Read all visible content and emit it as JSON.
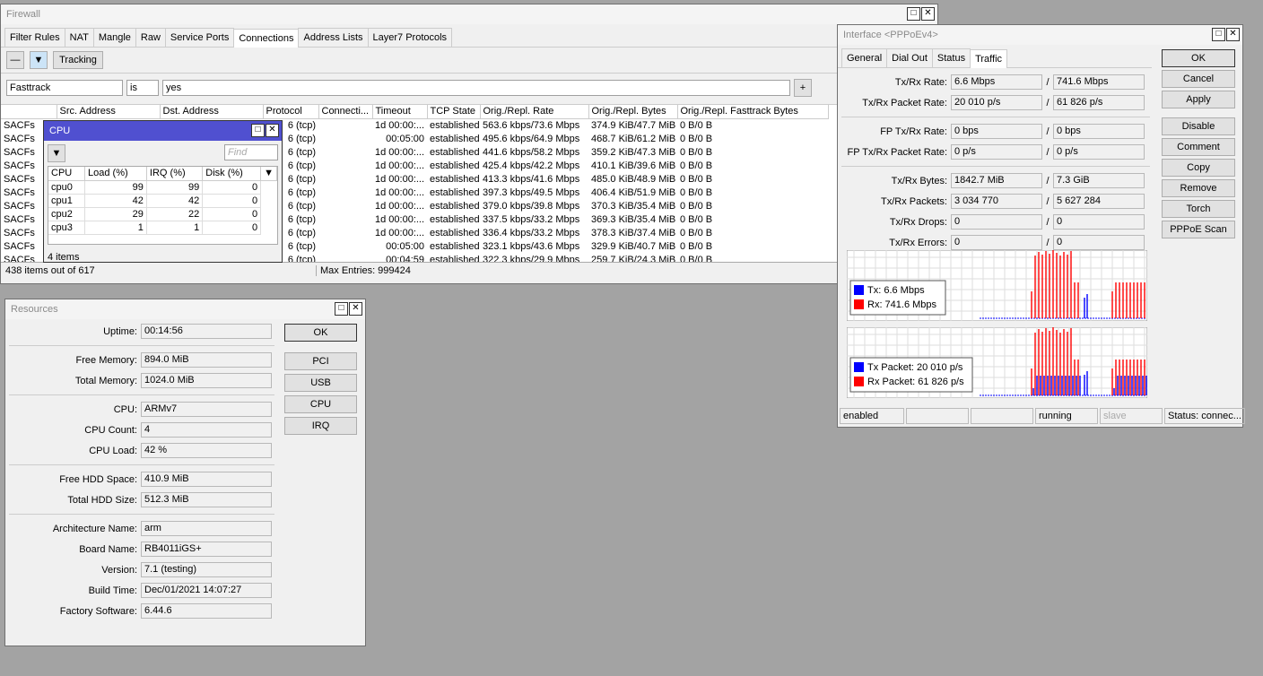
{
  "firewall": {
    "title": "Firewall",
    "tabs": [
      "Filter Rules",
      "NAT",
      "Mangle",
      "Raw",
      "Service Ports",
      "Connections",
      "Address Lists",
      "Layer7 Protocols"
    ],
    "active_tab": "Connections",
    "tracking_label": "Tracking",
    "filter": {
      "field": "Fasttrack",
      "op": "is",
      "value": "yes"
    },
    "columns": [
      "",
      "Src. Address",
      "Dst. Address",
      "Protocol",
      "Connecti...",
      "Timeout",
      "TCP State",
      "Orig./Repl. Rate",
      "Orig./Repl. Bytes",
      "Orig./Repl. Fasttrack Bytes"
    ],
    "rows": [
      [
        "SACFs",
        "6 (tcp)",
        "1d 00:00:...",
        "established",
        "563.6 kbps/73.6 Mbps",
        "374.9 KiB/47.7 MiB",
        "0 B/0 B"
      ],
      [
        "SACFs",
        "6 (tcp)",
        "00:05:00",
        "established",
        "495.6 kbps/64.9 Mbps",
        "468.7 KiB/61.2 MiB",
        "0 B/0 B"
      ],
      [
        "SACFs",
        "6 (tcp)",
        "1d 00:00:...",
        "established",
        "441.6 kbps/58.2 Mbps",
        "359.2 KiB/47.3 MiB",
        "0 B/0 B"
      ],
      [
        "SACFs",
        "6 (tcp)",
        "1d 00:00:...",
        "established",
        "425.4 kbps/42.2 Mbps",
        "410.1 KiB/39.6 MiB",
        "0 B/0 B"
      ],
      [
        "SACFs",
        "6 (tcp)",
        "1d 00:00:...",
        "established",
        "413.3 kbps/41.6 Mbps",
        "485.0 KiB/48.9 MiB",
        "0 B/0 B"
      ],
      [
        "SACFs",
        "6 (tcp)",
        "1d 00:00:...",
        "established",
        "397.3 kbps/49.5 Mbps",
        "406.4 KiB/51.9 MiB",
        "0 B/0 B"
      ],
      [
        "SACFs",
        "6 (tcp)",
        "1d 00:00:...",
        "established",
        "379.0 kbps/39.8 Mbps",
        "370.3 KiB/35.4 MiB",
        "0 B/0 B"
      ],
      [
        "SACFs",
        "6 (tcp)",
        "1d 00:00:...",
        "established",
        "337.5 kbps/33.2 Mbps",
        "369.3 KiB/35.4 MiB",
        "0 B/0 B"
      ],
      [
        "SACFs",
        "6 (tcp)",
        "1d 00:00:...",
        "established",
        "336.4 kbps/33.2 Mbps",
        "378.3 KiB/37.4 MiB",
        "0 B/0 B"
      ],
      [
        "SACFs",
        "6 (tcp)",
        "00:05:00",
        "established",
        "323.1 kbps/43.6 Mbps",
        "329.9 KiB/40.7 MiB",
        "0 B/0 B"
      ],
      [
        "SACFs",
        "6 (tcp)",
        "00:04:59",
        "established",
        "322.3 kbps/29.9 Mbps",
        "259.7 KiB/24.3 MiB",
        "0 B/0 B"
      ]
    ],
    "status_count": "438 items out of 617",
    "status_max": "Max Entries: 999424"
  },
  "cpu": {
    "title": "CPU",
    "find_placeholder": "Find",
    "columns": [
      "CPU",
      "Load (%)",
      "IRQ (%)",
      "Disk (%)"
    ],
    "rows": [
      [
        "cpu0",
        "99",
        "99",
        "0"
      ],
      [
        "cpu1",
        "42",
        "42",
        "0"
      ],
      [
        "cpu2",
        "29",
        "22",
        "0"
      ],
      [
        "cpu3",
        "1",
        "1",
        "0"
      ]
    ],
    "count": "4 items"
  },
  "resources": {
    "title": "Resources",
    "groups": [
      [
        [
          "Uptime:",
          "00:14:56"
        ]
      ],
      [
        [
          "Free Memory:",
          "894.0 MiB"
        ],
        [
          "Total Memory:",
          "1024.0 MiB"
        ]
      ],
      [
        [
          "CPU:",
          "ARMv7"
        ],
        [
          "CPU Count:",
          "4"
        ],
        [
          "CPU Load:",
          "42 %"
        ]
      ],
      [
        [
          "Free HDD Space:",
          "410.9 MiB"
        ],
        [
          "Total HDD Size:",
          "512.3 MiB"
        ]
      ],
      [
        [
          "Architecture Name:",
          "arm"
        ],
        [
          "Board Name:",
          "RB4011iGS+"
        ],
        [
          "Version:",
          "7.1 (testing)"
        ],
        [
          "Build Time:",
          "Dec/01/2021 14:07:27"
        ],
        [
          "Factory Software:",
          "6.44.6"
        ]
      ]
    ],
    "buttons": [
      "OK",
      "PCI",
      "USB",
      "CPU",
      "IRQ"
    ]
  },
  "interface": {
    "title": "Interface <PPPoEv4>",
    "tabs": [
      "General",
      "Dial Out",
      "Status",
      "Traffic"
    ],
    "active_tab": "Traffic",
    "groups": [
      [
        [
          "Tx/Rx Rate:",
          "6.6 Mbps",
          "741.6 Mbps"
        ],
        [
          "Tx/Rx Packet Rate:",
          "20 010 p/s",
          "61 826 p/s"
        ]
      ],
      [
        [
          "FP Tx/Rx Rate:",
          "0 bps",
          "0 bps"
        ],
        [
          "FP Tx/Rx Packet Rate:",
          "0 p/s",
          "0 p/s"
        ]
      ],
      [
        [
          "Tx/Rx Bytes:",
          "1842.7 MiB",
          "7.3 GiB"
        ],
        [
          "Tx/Rx Packets:",
          "3 034 770",
          "5 627 284"
        ],
        [
          "Tx/Rx Drops:",
          "0",
          "0"
        ],
        [
          "Tx/Rx Errors:",
          "0",
          "0"
        ]
      ]
    ],
    "buttons": [
      "OK",
      "Cancel",
      "Apply",
      "Disable",
      "Comment",
      "Copy",
      "Remove",
      "Torch",
      "PPPoE Scan"
    ],
    "legend1": [
      {
        "label": "Tx:  6.6 Mbps",
        "color": "#0000ff"
      },
      {
        "label": "Rx:  741.6 Mbps",
        "color": "#ff0000"
      }
    ],
    "legend2": [
      {
        "label": "Tx Packet:  20 010 p/s",
        "color": "#0000ff"
      },
      {
        "label": "Rx Packet:  61 826 p/s",
        "color": "#ff0000"
      }
    ],
    "status": [
      "enabled",
      "",
      "",
      "running",
      "slave",
      "Status: connec..."
    ]
  }
}
